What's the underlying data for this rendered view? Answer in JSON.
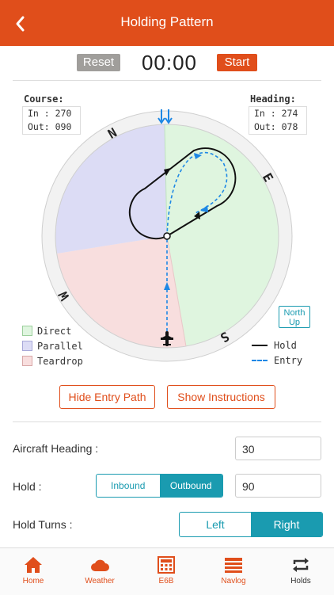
{
  "header": {
    "title": "Holding Pattern",
    "back_icon": "chevron-left-icon"
  },
  "timer": {
    "reset_label": "Reset",
    "time": "00:00",
    "start_label": "Start"
  },
  "course": {
    "title": "Course:",
    "in_label": "In : 270",
    "out_label": "Out: 090"
  },
  "heading": {
    "title": "Heading:",
    "in_label": "In : 274",
    "out_label": "Out: 078"
  },
  "compass": {
    "n": "N",
    "e": "E",
    "s": "S",
    "w": "W",
    "north_up_1": "North",
    "north_up_2": "Up"
  },
  "legend": {
    "direct": "Direct",
    "parallel": "Parallel",
    "teardrop": "Teardrop",
    "hold": "Hold",
    "entry": "Entry"
  },
  "actions": {
    "hide_entry": "Hide Entry Path",
    "show_instructions": "Show Instructions"
  },
  "form": {
    "aircraft_heading_label": "Aircraft Heading :",
    "aircraft_heading_value": "30",
    "hold_label": "Hold :",
    "inbound_label": "Inbound",
    "outbound_label": "Outbound",
    "hold_value": "90",
    "hold_turns_label": "Hold Turns :",
    "left_label": "Left",
    "right_label": "Right"
  },
  "colors": {
    "accent": "#e04e1b",
    "teal": "#1a9bb0",
    "direct": "#dff5df",
    "parallel": "#dcdcf5",
    "teardrop": "#f8dede",
    "entry": "#1e88e5"
  },
  "tabs": [
    {
      "label": "Home",
      "icon": "home-icon"
    },
    {
      "label": "Weather",
      "icon": "cloud-icon"
    },
    {
      "label": "E6B",
      "icon": "calculator-icon"
    },
    {
      "label": "Navlog",
      "icon": "list-icon"
    },
    {
      "label": "Holds",
      "icon": "holds-icon"
    }
  ]
}
